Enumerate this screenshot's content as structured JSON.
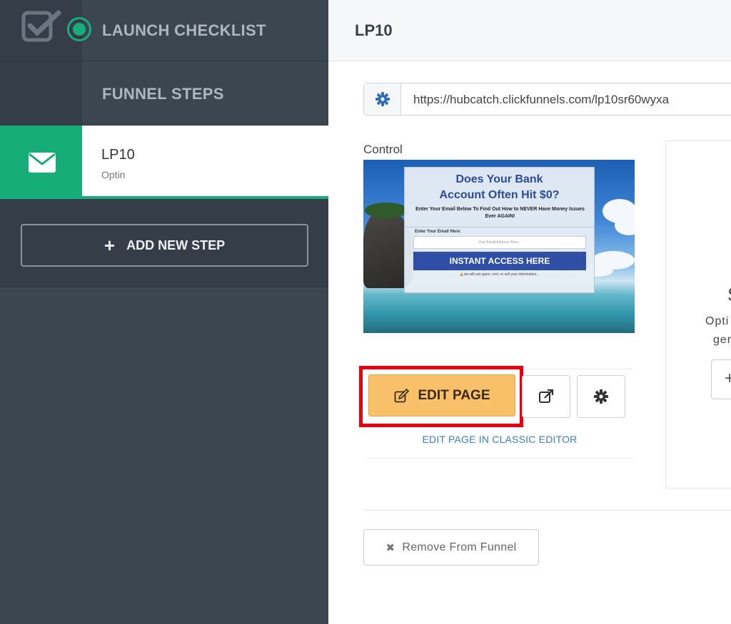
{
  "sidebar": {
    "launch_checklist": "LAUNCH CHECKLIST",
    "funnel_steps": "FUNNEL STEPS",
    "active_step": {
      "name": "LP10",
      "type": "Optin"
    },
    "add_new_step": "ADD NEW STEP",
    "add_icon": "+"
  },
  "header": {
    "title": "LP10"
  },
  "url_bar": {
    "url": "https://hubcatch.clickfunnels.com/lp10sr60wyxa"
  },
  "variant": {
    "label": "Control",
    "thumbnail": {
      "title_line1": "Does Your Bank",
      "title_line2": "Account Often Hit $0?",
      "subtitle": "Enter Your Email Below To Find Out How to NEVER Have Money Issues Ever AGAIN!",
      "email_label": "Enter Your Email Here:",
      "email_placeholder": "Your Email Address Here...",
      "button": "INSTANT ACCESS HERE",
      "privacy_note": "we will not spam, rent, or sell your information..."
    }
  },
  "actions": {
    "edit_page": "EDIT PAGE",
    "classic_editor": "EDIT PAGE IN CLASSIC EDITOR",
    "remove_from_funnel": "Remove From Funnel",
    "remove_icon": "✖"
  },
  "stats_panel": {
    "big": "S",
    "line1": "Opti",
    "line2": "ger",
    "button": "+"
  },
  "colors": {
    "accent_green": "#17ad79",
    "edit_button": "#f9c06a",
    "highlight": "#e8000f",
    "link_blue": "#3b7fc4"
  }
}
